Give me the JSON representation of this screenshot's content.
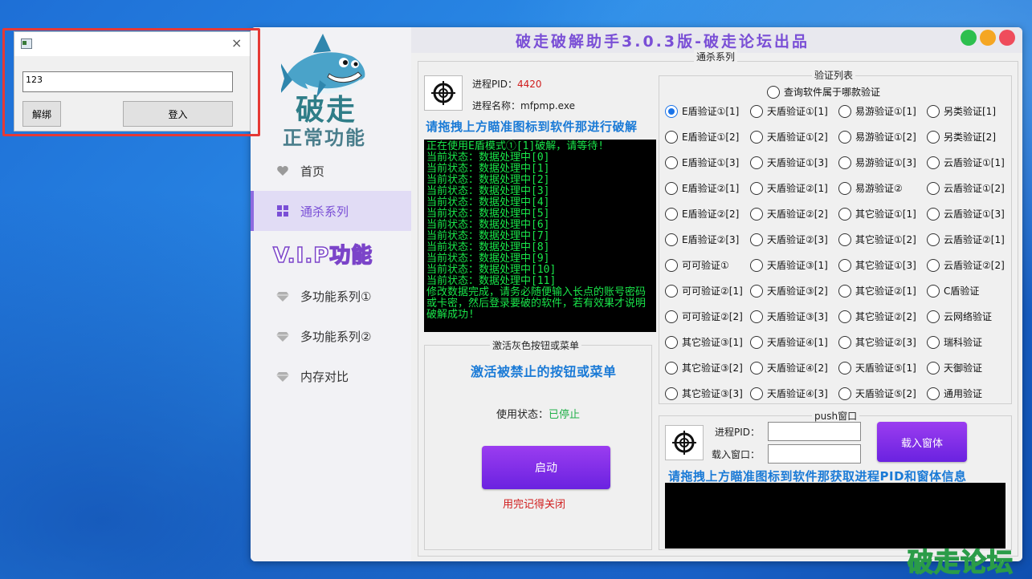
{
  "login_window": {
    "input_value": "123",
    "unbind_label": "解绑",
    "login_label": "登入",
    "close_glyph": "×"
  },
  "app": {
    "title": "破走破解助手3.0.3版-破走论坛出品",
    "brand_char": "破走",
    "section_normal": "正常功能",
    "section_vip": "V.I.P功能",
    "window_buttons": {
      "green": "#2dbf4e",
      "orange": "#f5a623",
      "red": "#ef4c5c"
    }
  },
  "sidebar": {
    "items": [
      {
        "label": "首页",
        "icon": "heart-icon",
        "active": false
      },
      {
        "label": "通杀系列",
        "icon": "grid-icon",
        "active": true
      },
      {
        "label": "多功能系列①",
        "icon": "diamond-icon",
        "active": false
      },
      {
        "label": "多功能系列②",
        "icon": "diamond-icon",
        "active": false
      },
      {
        "label": "内存对比",
        "icon": "diamond-icon",
        "active": false
      }
    ]
  },
  "main": {
    "group_title": "通杀系列",
    "pid_label": "进程PID：",
    "pid_value": "4420",
    "proc_label": "进程名称：",
    "proc_value": "mfpmp.exe",
    "drag_hint": "请拖拽上方瞄准图标到软件那进行破解",
    "console_lines": [
      "正在使用E盾模式①[1]破解，请等待!",
      "当前状态：数据处理中[0]",
      "当前状态：数据处理中[1]",
      "当前状态：数据处理中[2]",
      "当前状态：数据处理中[3]",
      "当前状态：数据处理中[4]",
      "当前状态：数据处理中[5]",
      "当前状态：数据处理中[6]",
      "当前状态：数据处理中[7]",
      "当前状态：数据处理中[8]",
      "当前状态：数据处理中[9]",
      "当前状态：数据处理中[10]",
      "当前状态：数据处理中[11]"
    ],
    "console_tail": "修改数据完成，请务必随便输入长点的账号密码或卡密，然后登录要破的软件，若有效果才说明破解成功!",
    "activate_group": "激活灰色按钮或菜单",
    "activate_title": "激活被禁止的按钮或菜单",
    "status_label": "使用状态：",
    "status_value": "已停止",
    "start_label": "启动",
    "close_note": "用完记得关闭"
  },
  "verify": {
    "group_title": "验证列表",
    "query_option": "查询软件属于哪款验证",
    "columns": [
      [
        "E盾验证①[1]",
        "E盾验证①[2]",
        "E盾验证①[3]",
        "E盾验证②[1]",
        "E盾验证②[2]",
        "E盾验证②[3]",
        "可可验证①",
        "可可验证②[1]",
        "可可验证②[2]",
        "其它验证③[1]",
        "其它验证③[2]",
        "其它验证③[3]"
      ],
      [
        "天盾验证①[1]",
        "天盾验证①[2]",
        "天盾验证①[3]",
        "天盾验证②[1]",
        "天盾验证②[2]",
        "天盾验证②[3]",
        "天盾验证③[1]",
        "天盾验证③[2]",
        "天盾验证③[3]",
        "天盾验证④[1]",
        "天盾验证④[2]",
        "天盾验证④[3]"
      ],
      [
        "易游验证①[1]",
        "易游验证①[2]",
        "易游验证①[3]",
        "易游验证②",
        "其它验证①[1]",
        "其它验证①[2]",
        "其它验证①[3]",
        "其它验证②[1]",
        "其它验证②[2]",
        "其它验证②[3]",
        "天盾验证⑤[1]",
        "天盾验证⑤[2]"
      ],
      [
        "另类验证[1]",
        "另类验证[2]",
        "云盾验证①[1]",
        "云盾验证①[2]",
        "云盾验证①[3]",
        "云盾验证②[1]",
        "云盾验证②[2]",
        "C盾验证",
        "云网络验证",
        "瑞科验证",
        "天御验证",
        "通用验证"
      ]
    ],
    "selected": "E盾验证①[1]"
  },
  "push": {
    "group_title": "push窗口",
    "pid_label": "进程PID：",
    "window_label": "载入窗口：",
    "load_button": "载入窗体",
    "hint": "请拖拽上方瞄准图标到软件那获取进程PID和窗体信息"
  },
  "watermark": "破走论坛"
}
